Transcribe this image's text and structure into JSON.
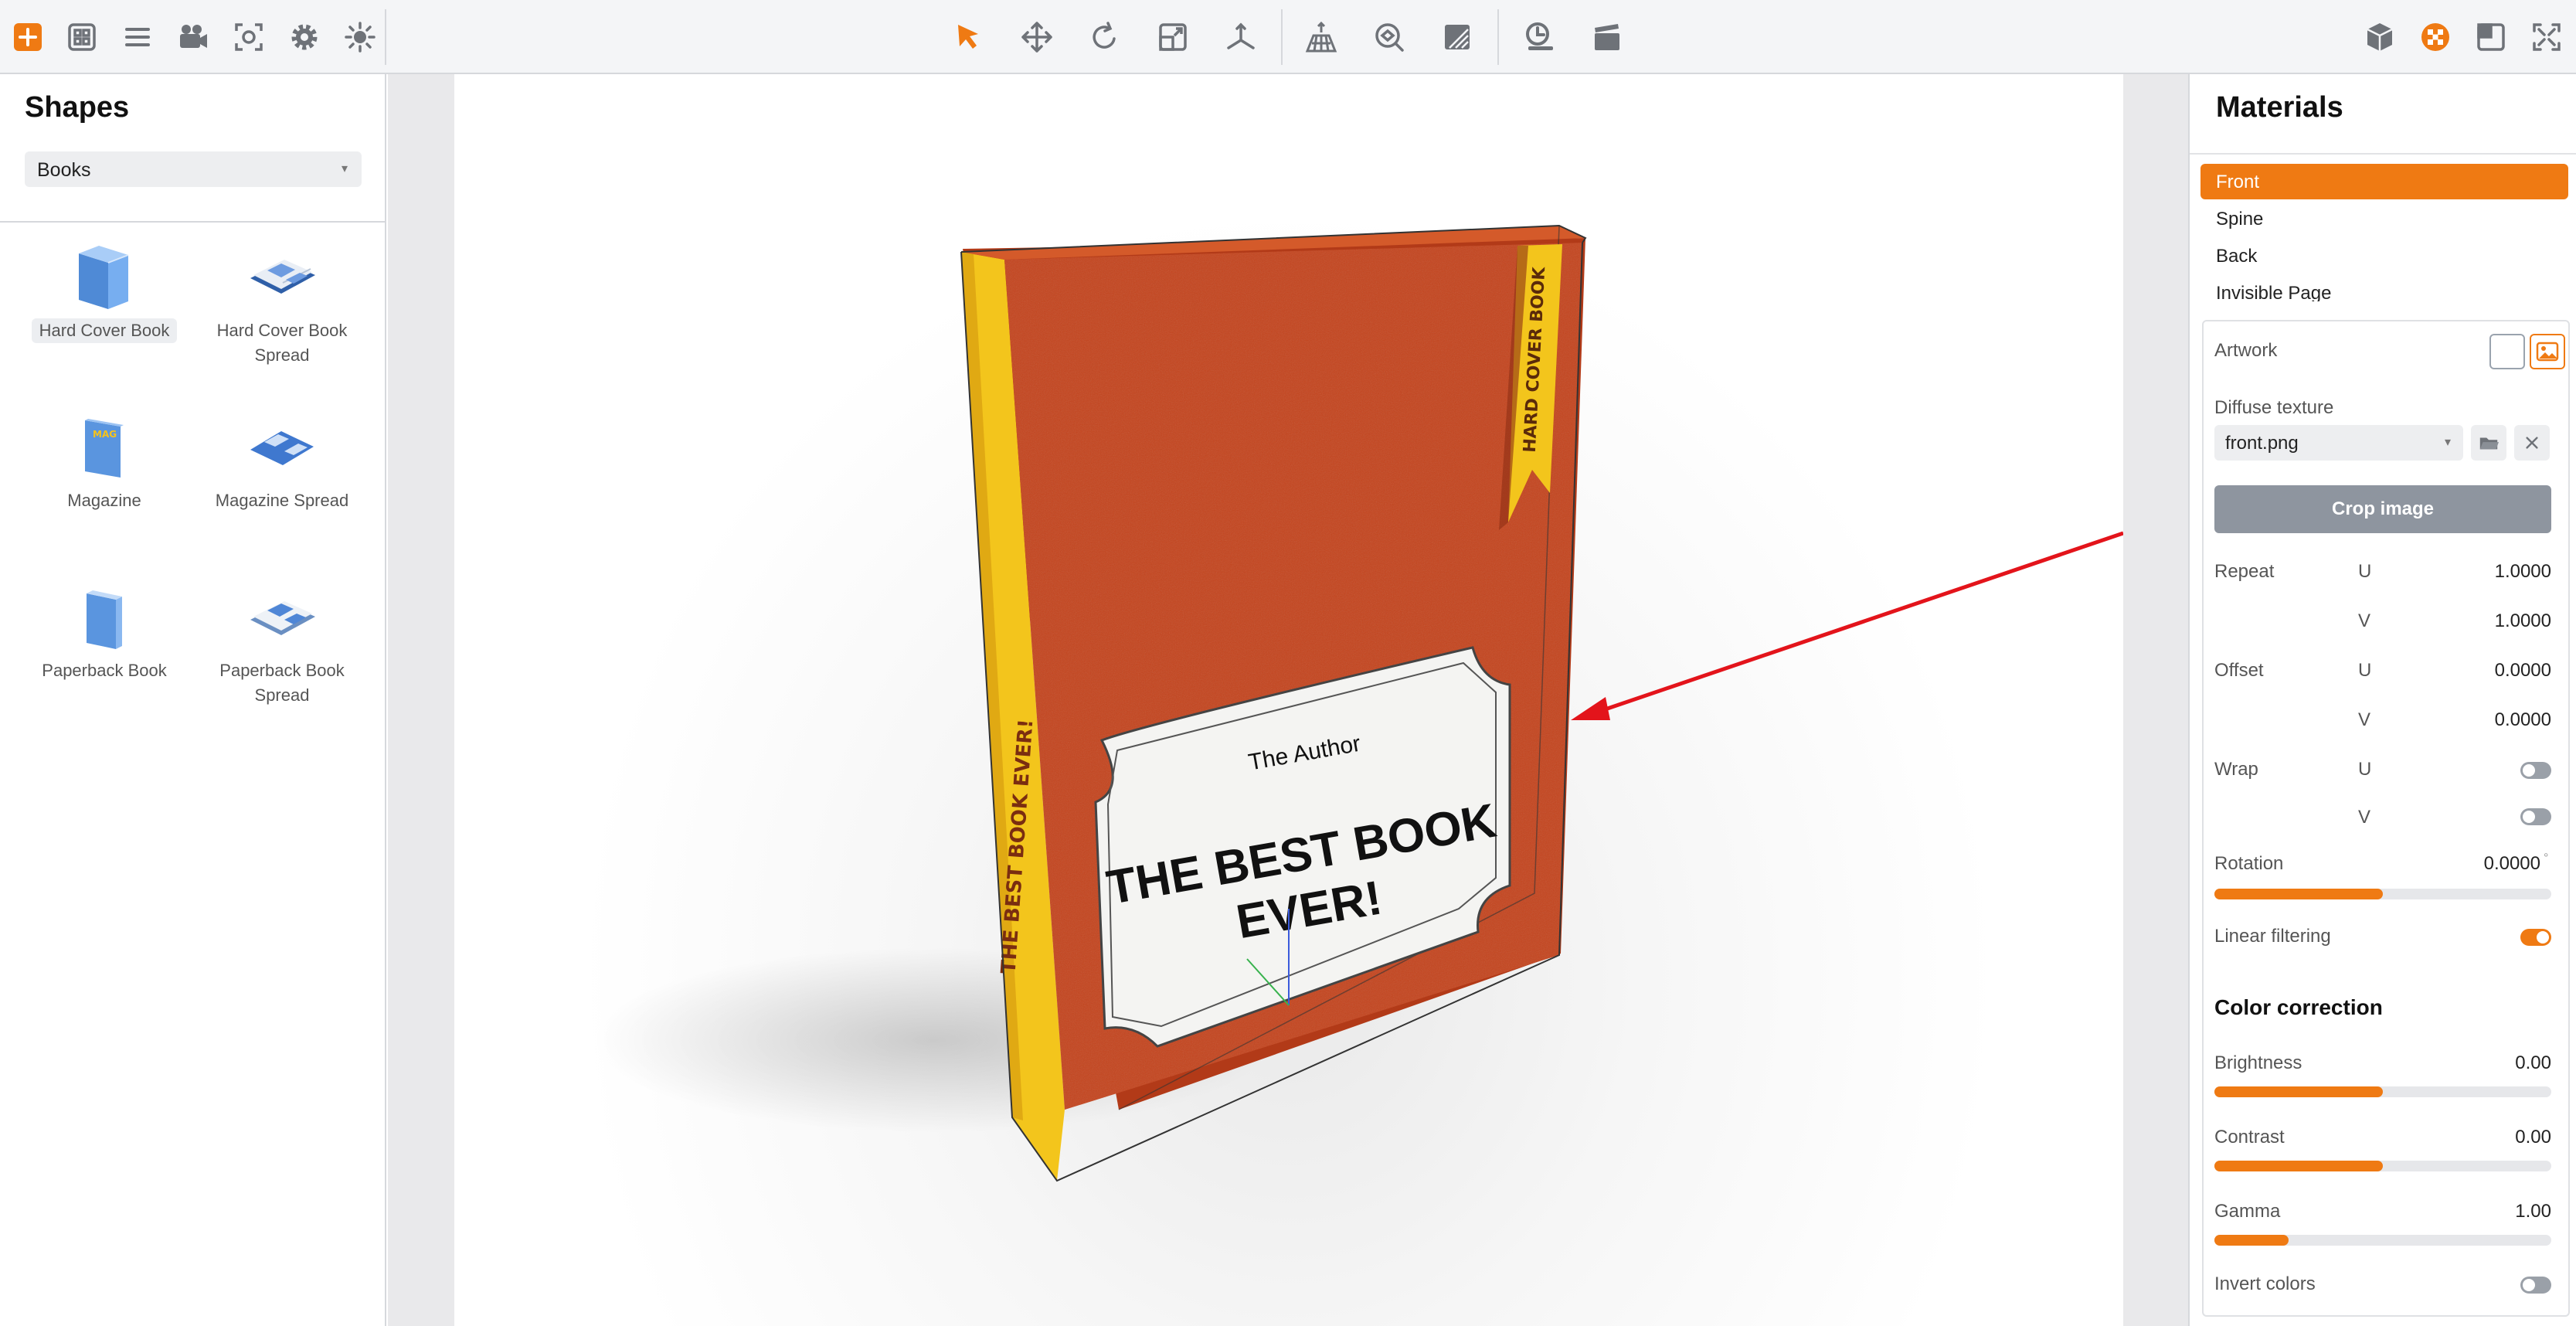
{
  "toolbar": {
    "left_icons": [
      "add-icon",
      "grid-icon",
      "list-icon",
      "camera-icon",
      "focus-icon",
      "gear-icon",
      "sun-icon"
    ],
    "center_icons": [
      "select-arrow-icon",
      "move-icon",
      "rotate-icon",
      "scale-icon",
      "axes-icon",
      "floor-grid-icon",
      "orbit-icon",
      "background-icon",
      "timer-icon",
      "clapperboard-icon"
    ],
    "right_icons": [
      "cube-icon",
      "materials-icon",
      "panel-icon",
      "fullscreen-icon"
    ],
    "accent": "#ef7a13"
  },
  "shapes_panel": {
    "title": "Shapes",
    "category": "Books",
    "items": [
      {
        "label": "Hard Cover Book",
        "selected": true
      },
      {
        "label": "Hard Cover Book Spread",
        "selected": false
      },
      {
        "label": "Magazine",
        "selected": false
      },
      {
        "label": "Magazine Spread",
        "selected": false
      },
      {
        "label": "Paperback Book",
        "selected": false
      },
      {
        "label": "Paperback Book Spread",
        "selected": false
      }
    ]
  },
  "scene": {
    "spine_text": "THE BEST BOOK EVER!",
    "ribbon_text": "HARD COVER BOOK",
    "author": "The Author",
    "title_line1": "THE BEST BOOK",
    "title_line2": "EVER!",
    "cover_color": "#c4431c",
    "spine_color": "#f3c51c",
    "arrow_color": "#e3141b"
  },
  "materials_panel": {
    "title": "Materials",
    "materials": [
      "Front",
      "Spine",
      "Back",
      "Invisible Page"
    ],
    "active": "Front",
    "artwork_label": "Artwork",
    "diffuse_label": "Diffuse texture",
    "diffuse_value": "front.png",
    "crop_label": "Crop image",
    "repeat_label": "Repeat",
    "repeat_u": "1.0000",
    "repeat_v": "1.0000",
    "offset_label": "Offset",
    "offset_u": "0.0000",
    "offset_v": "0.0000",
    "wrap_label": "Wrap",
    "wrap_u": false,
    "wrap_v": false,
    "u_label": "U",
    "v_label": "V",
    "rotation_label": "Rotation",
    "rotation_value": "0.0000",
    "rotation_unit": "°",
    "rotation_fill": 0.5,
    "linear_label": "Linear filtering",
    "linear_on": true,
    "color_correction_title": "Color correction",
    "brightness_label": "Brightness",
    "brightness_value": "0.00",
    "brightness_fill": 0.5,
    "contrast_label": "Contrast",
    "contrast_value": "0.00",
    "contrast_fill": 0.5,
    "gamma_label": "Gamma",
    "gamma_value": "1.00",
    "gamma_fill": 0.22,
    "invert_label": "Invert colors",
    "invert_on": false
  }
}
